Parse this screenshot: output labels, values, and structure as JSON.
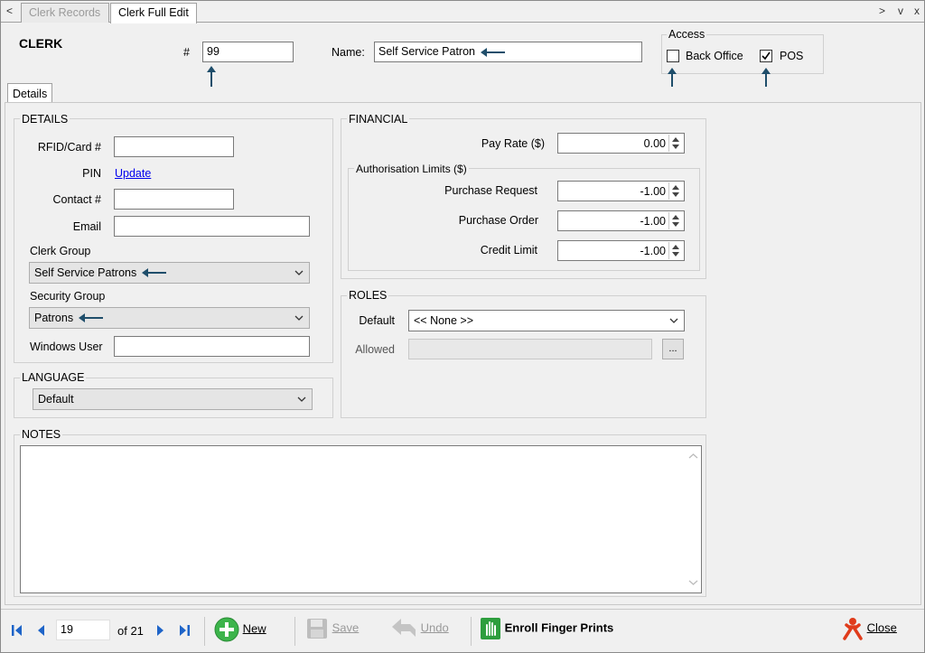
{
  "tabs": {
    "inactive": "Clerk Records",
    "active": "Clerk Full Edit",
    "nav_left": "<",
    "nav_right": ">",
    "nav_down": "v",
    "close": "x"
  },
  "header": {
    "title": "CLERK",
    "number_label": "#",
    "number_value": "99",
    "name_label": "Name:",
    "name_value": "Self Service Patron",
    "access_title": "Access",
    "back_office_label": "Back Office",
    "back_office_checked": false,
    "pos_label": "POS",
    "pos_checked": true
  },
  "page_tab": "Details",
  "details": {
    "title": "DETAILS",
    "rfid_label": "RFID/Card #",
    "rfid_value": "",
    "pin_label": "PIN",
    "pin_link": "Update",
    "contact_label": "Contact #",
    "contact_value": "",
    "email_label": "Email",
    "email_value": "",
    "clerk_group_label": "Clerk Group",
    "clerk_group_value": "Self Service Patrons",
    "security_group_label": "Security Group",
    "security_group_value": "Patrons",
    "windows_user_label": "Windows User",
    "windows_user_value": ""
  },
  "language": {
    "title": "LANGUAGE",
    "value": "Default"
  },
  "financial": {
    "title": "FINANCIAL",
    "pay_rate_label": "Pay Rate ($)",
    "pay_rate_value": "0.00",
    "auth_title": "Authorisation Limits ($)",
    "purchase_request_label": "Purchase Request",
    "purchase_request_value": "-1.00",
    "purchase_order_label": "Purchase Order",
    "purchase_order_value": "-1.00",
    "credit_limit_label": "Credit Limit",
    "credit_limit_value": "-1.00"
  },
  "roles": {
    "title": "ROLES",
    "default_label": "Default",
    "default_value": "<< None >>",
    "allowed_label": "Allowed",
    "allowed_value": "",
    "browse_label": "..."
  },
  "notes": {
    "title": "NOTES",
    "value": ""
  },
  "toolbar": {
    "record_value": "19",
    "record_total": "of 21",
    "new_label": "New",
    "save_label": "Save",
    "undo_label": "Undo",
    "enroll_label": "Enroll Finger Prints",
    "close_label": "Close"
  },
  "colors": {
    "annotation_arrow": "#1f4e6b",
    "new_icon": "#3cb44b",
    "enroll_icon": "#2e9e3e",
    "close_icon": "#e03c1c"
  }
}
